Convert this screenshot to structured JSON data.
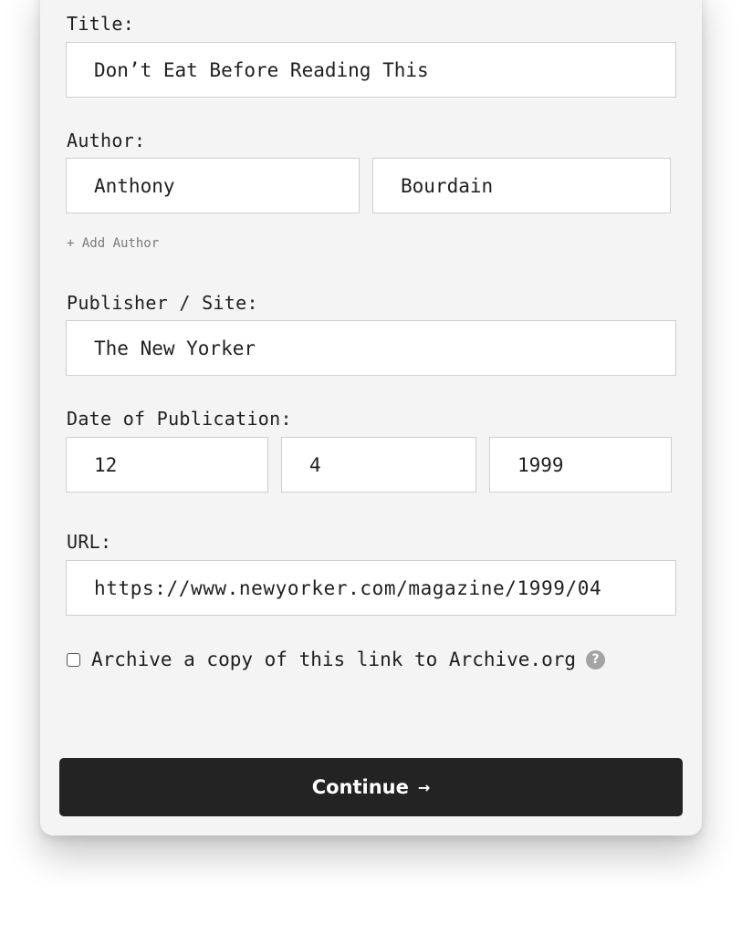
{
  "form": {
    "title_label": "Title:",
    "title_value": "Don’t Eat Before Reading This",
    "author_label": "Author:",
    "author_first": "Anthony",
    "author_last": "Bourdain",
    "add_author": "+ Add Author",
    "publisher_label": "Publisher / Site:",
    "publisher_value": "The New Yorker",
    "date_label": "Date of Publication:",
    "date_month": "12",
    "date_day": "4",
    "date_year": "1999",
    "url_label": "URL:",
    "url_value": "https://www.newyorker.com/magazine/1999/04",
    "archive_label": "Archive a copy of this link to Archive.org",
    "archive_checked": false,
    "help_glyph": "?",
    "continue_label": "Continue",
    "continue_arrow": "→"
  },
  "icons": {
    "help": "question-circle-icon",
    "continue_arrow": "arrow-right-icon",
    "checkbox": "checkbox-unchecked"
  },
  "colors": {
    "card_bg": "#f4f4f4",
    "button_bg": "#232323",
    "button_text": "#ffffff",
    "muted_text": "#7a7a7a",
    "help_icon": "#a3a3a3"
  }
}
